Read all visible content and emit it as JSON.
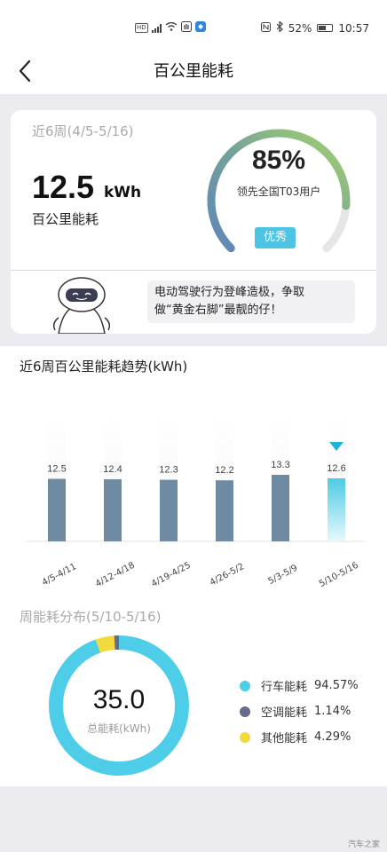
{
  "status_bar": {
    "left_icons": [
      "hd-icon",
      "5g-signal-icon",
      "wifi-icon",
      "hand-icon",
      "app-icon"
    ],
    "battery": "52%",
    "time": "10:57"
  },
  "header": {
    "title": "百公里能耗"
  },
  "summary": {
    "period": "近6周(4/5-5/16)",
    "value": "12.5",
    "unit": "kWh",
    "label": "百公里能耗",
    "rank_percent": "85%",
    "rank_text": "领先全国T03用户",
    "badge": "优秀",
    "rank_fraction": 0.85,
    "tip_line1": "电动驾驶行为登峰造极，争取",
    "tip_line2": "做“黄金右脚”最靓的仔！"
  },
  "trend": {
    "title": "近6周百公里能耗趋势(kWh)",
    "chart_data": {
      "type": "bar",
      "categories": [
        "4/5-4/11",
        "4/12-4/18",
        "4/19-4/25",
        "4/26-5/2",
        "5/3-5/9",
        "5/10-5/16"
      ],
      "values": [
        12.5,
        12.4,
        12.3,
        12.2,
        13.3,
        12.6
      ],
      "highlight_index": 5,
      "bar_color": "#6f8aa3",
      "highlight_color": "#4fcbe3"
    }
  },
  "distribution": {
    "title": "周能耗分布(5/10-5/16)",
    "total_value": "35.0",
    "total_label": "总能耗(kWh)",
    "chart_data": {
      "type": "pie",
      "labels": [
        "行车能耗",
        "空调能耗",
        "其他能耗"
      ],
      "values": [
        94.57,
        1.14,
        4.29
      ],
      "display": [
        "94.57%",
        "1.14%",
        "4.29%"
      ],
      "colors": [
        "#4dcde8",
        "#666a8c",
        "#f2d93c"
      ]
    }
  },
  "watermark": "汽车之家"
}
